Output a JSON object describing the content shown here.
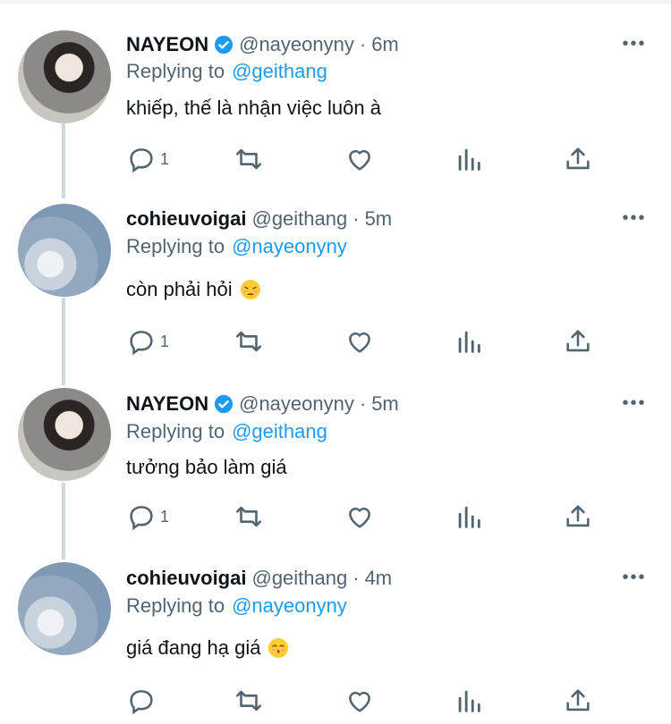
{
  "tweets": [
    {
      "name": "NAYEON",
      "verified": true,
      "handle": "@nayeonyny",
      "sep": "·",
      "time": "6m",
      "replying_label": "Replying to",
      "replying_to": "@geithang",
      "text": "khiếp, thế là nhận việc luôn à",
      "emoji": "",
      "reply_count": "1",
      "avatar": "girl"
    },
    {
      "name": "cohieuvoigai",
      "verified": false,
      "handle": "@geithang",
      "sep": "·",
      "time": "5m",
      "replying_label": "Replying to",
      "replying_to": "@nayeonyny",
      "text": "còn phải hỏi",
      "emoji": "weary-face",
      "reply_count": "1",
      "avatar": "sky"
    },
    {
      "name": "NAYEON",
      "verified": true,
      "handle": "@nayeonyny",
      "sep": "·",
      "time": "5m",
      "replying_label": "Replying to",
      "replying_to": "@geithang",
      "text": "tưởng bảo làm giá",
      "emoji": "",
      "reply_count": "1",
      "avatar": "girl"
    },
    {
      "name": "cohieuvoigai",
      "verified": false,
      "handle": "@geithang",
      "sep": "·",
      "time": "4m",
      "replying_label": "Replying to",
      "replying_to": "@nayeonyny",
      "text": "giá đang hạ giá",
      "emoji": "kissing-face",
      "reply_count": "",
      "avatar": "sky"
    }
  ],
  "icons": {
    "reply": "reply-icon",
    "retweet": "retweet-icon",
    "like": "heart-icon",
    "views": "analytics-icon",
    "share": "share-icon",
    "more": "more-icon",
    "verified": "verified-badge-icon"
  },
  "colors": {
    "accent": "#1d9bf0",
    "muted": "#536471",
    "text": "#0f1419",
    "thread": "#cfd9de"
  }
}
